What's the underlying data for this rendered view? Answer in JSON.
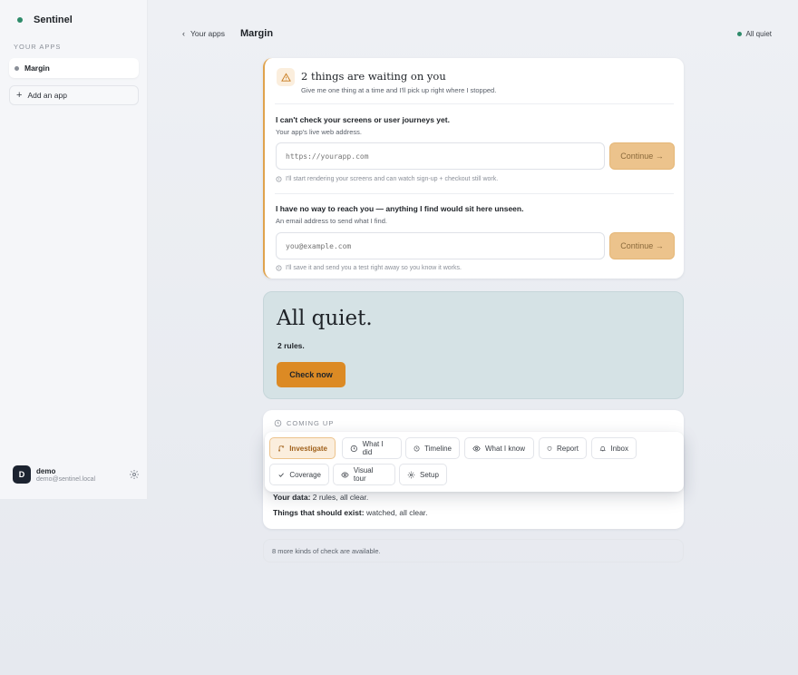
{
  "sidebar": {
    "brand": "Sentinel",
    "section_label": "YOUR APPS",
    "apps": [
      {
        "label": "Margin"
      }
    ],
    "add_app_label": "Add an app",
    "user": {
      "initial": "D",
      "name": "demo",
      "email": "demo@sentinel.local"
    }
  },
  "header": {
    "back_label": "Your apps",
    "title": "Margin",
    "status": "All quiet"
  },
  "waiting": {
    "title": "2 things are waiting on you",
    "subtitle": "Give me one thing at a time and I'll pick up right where I stopped.",
    "questions": [
      {
        "title": "I can't check your screens or user journeys yet.",
        "subtitle": "Your app's live web address.",
        "placeholder": "https://yourapp.com",
        "button": "Continue →",
        "hint": "I'll start rendering your screens and can watch sign-up + checkout still work."
      },
      {
        "title": "I have no way to reach you — anything I find would sit here unseen.",
        "subtitle": "An email address to send what I find.",
        "placeholder": "you@example.com",
        "button": "Continue →",
        "hint": "I'll save it and send you a test right away so you know it works."
      }
    ]
  },
  "quiet": {
    "title": "All quiet.",
    "rules": "2 rules.",
    "button": "Check now"
  },
  "coming_up": {
    "label": "COMING UP",
    "data_key": "Your data:",
    "data_value": " 2 rules, all clear.",
    "exist_key": "Things that should exist:",
    "exist_value": " watched, all clear."
  },
  "menu": {
    "items": [
      {
        "label": "Investigate",
        "icon": "branch-icon",
        "active": true
      },
      {
        "label": "What I did",
        "icon": "clock-icon"
      },
      {
        "label": "Timeline",
        "icon": "clock-icon"
      },
      {
        "label": "What I know",
        "icon": "eye-icon"
      },
      {
        "label": "Report",
        "icon": "shield-icon"
      },
      {
        "label": "Inbox",
        "icon": "bell-icon"
      },
      {
        "label": "Coverage",
        "icon": "check-icon"
      },
      {
        "label": "Visual tour",
        "icon": "eye-icon"
      },
      {
        "label": "Setup",
        "icon": "gear-icon"
      }
    ]
  },
  "more_checks": "8 more kinds of check are available.",
  "colors": {
    "accent": "#dc8a24",
    "status_green": "#2e8b6a",
    "quiet_bg": "#d5e2e5"
  }
}
